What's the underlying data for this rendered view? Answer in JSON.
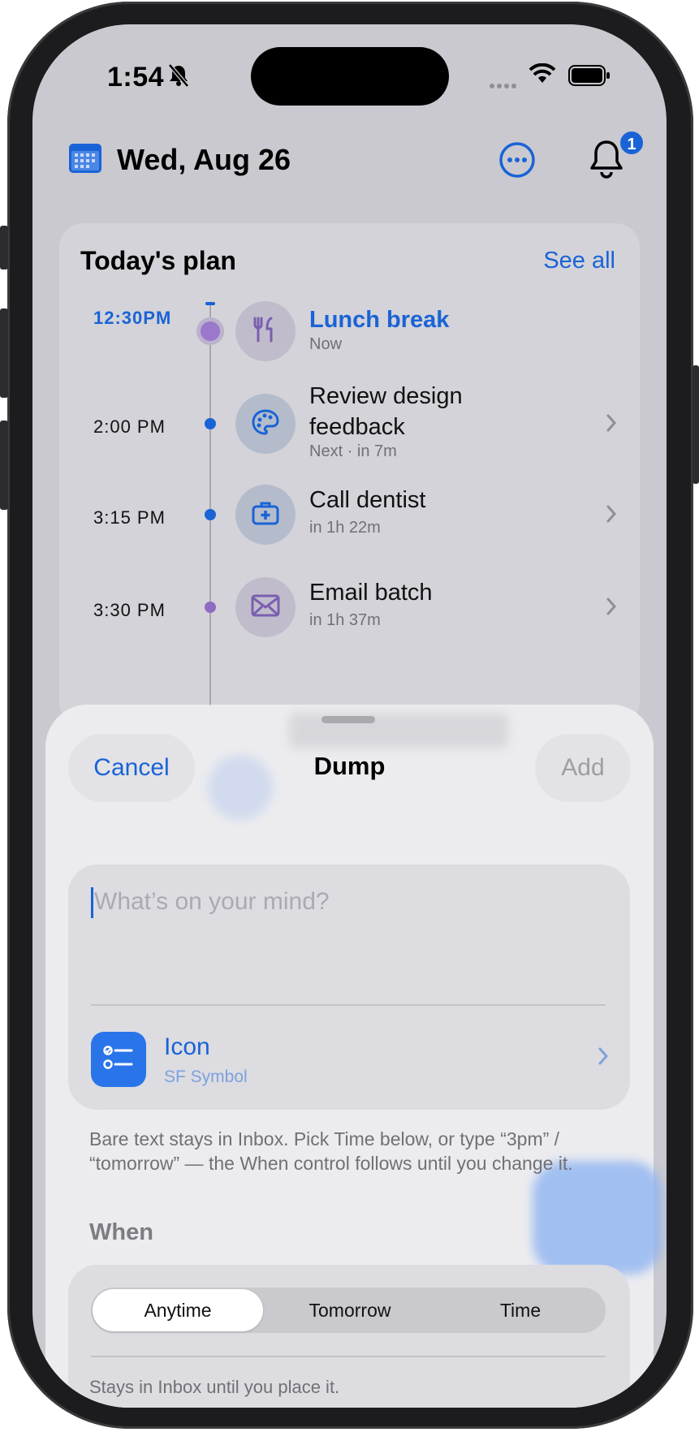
{
  "status_bar": {
    "time": "1:54"
  },
  "header": {
    "date": "Wed, Aug 26",
    "notification_count": "1"
  },
  "plan": {
    "title": "Today's plan",
    "see_all": "See all",
    "items": [
      {
        "time": "12:30PM",
        "title": "Lunch break",
        "subtitle": "Now",
        "icon": "fork-knife-icon",
        "state": "now"
      },
      {
        "time": "2:00 PM",
        "title": "Review design feedback",
        "subtitle": "Next · in 7m",
        "icon": "palette-icon",
        "state": "next"
      },
      {
        "time": "3:15 PM",
        "title": "Call dentist",
        "subtitle": "in 1h 22m",
        "icon": "medical-kit-icon",
        "state": "upcoming"
      },
      {
        "time": "3:30 PM",
        "title": "Email batch",
        "subtitle": "in 1h 37m",
        "icon": "envelope-icon",
        "state": "upcoming"
      }
    ]
  },
  "sheet": {
    "cancel": "Cancel",
    "title": "Dump",
    "add": "Add",
    "input_placeholder": "What’s on your mind?",
    "icon_label": "Icon",
    "icon_sub": "SF Symbol",
    "help": "Bare text stays in Inbox. Pick Time below, or type “3pm” / “tomorrow” — the When control follows until you change it.",
    "when_label": "When",
    "when_options": [
      "Anytime",
      "Tomorrow",
      "Time"
    ],
    "when_selected": "Anytime",
    "when_hint": "Stays in Inbox until you place it."
  },
  "colors": {
    "accent": "#1a63d6",
    "purple": "#8f6cc1"
  }
}
